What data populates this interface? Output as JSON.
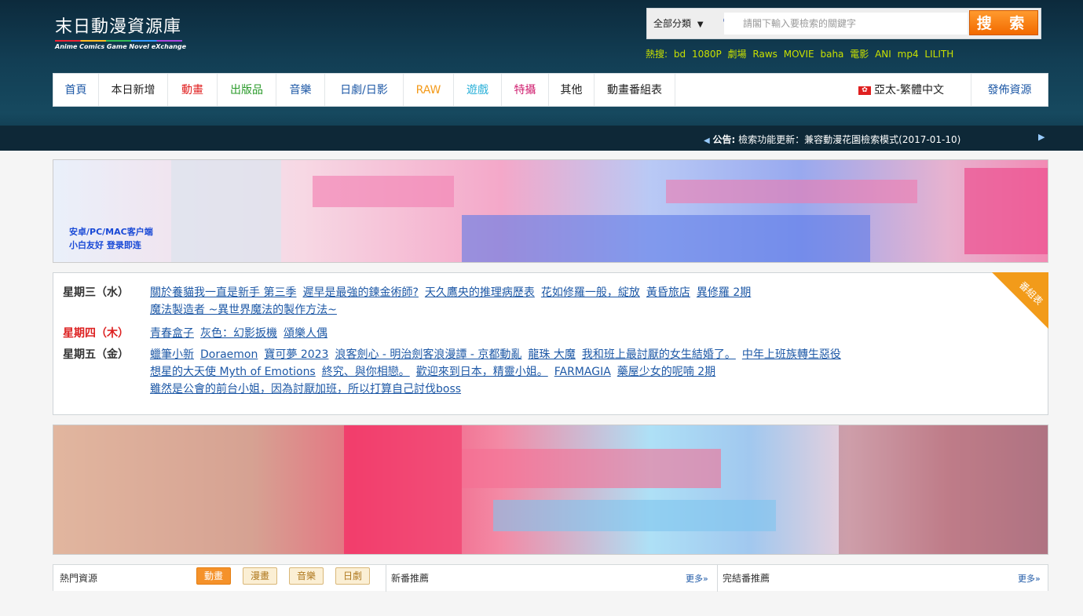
{
  "logo": {
    "name": "末日動漫資源庫",
    "tagline": "Anime Comics Game Novel eXchange"
  },
  "search": {
    "category": "全部分類",
    "placeholder": "請閣下輸入要檢索的關鍵字",
    "button": "搜 索"
  },
  "hot_search": {
    "label": "熱搜:",
    "terms": [
      "bd",
      "1080P",
      "劇場",
      "Raws",
      "MOVIE",
      "baha",
      "電影",
      "ANI",
      "mp4",
      "LILITH"
    ]
  },
  "nav": {
    "items": [
      {
        "label": "首頁",
        "color": "#1d58a6"
      },
      {
        "label": "本日新增",
        "color": "#222222"
      },
      {
        "label": "動畫",
        "color": "#e02020"
      },
      {
        "label": "出版品",
        "color": "#2a9a2a"
      },
      {
        "label": "音樂",
        "color": "#1d58a6"
      },
      {
        "label": "日劇/日影",
        "color": "#1d58a6"
      },
      {
        "label": "RAW",
        "color": "#f39a1a"
      },
      {
        "label": "遊戲",
        "color": "#2ab0d8"
      },
      {
        "label": "特攝",
        "color": "#d02070"
      },
      {
        "label": "其他",
        "color": "#222222"
      },
      {
        "label": "動畫番組表",
        "color": "#222222"
      }
    ],
    "region": "亞太-繁體中文",
    "publish": "發佈資源"
  },
  "announcement": {
    "label": "公告:",
    "text": "檢索功能更新：兼容動漫花園檢索模式(2017-01-10)"
  },
  "banner1": {
    "lines": [
      "安卓/PC/MAC客户端",
      "小白友好 登录即连"
    ]
  },
  "schedule": {
    "corner_label": "番組表",
    "days": [
      {
        "day": "星期三（水）",
        "today": false,
        "titles": [
          "關於養貓我一直是新手 第三季",
          "遲早是最強的鍊金術師?",
          "天久鷹央的推理病歷表",
          "花如修羅一般，綻放",
          "黃昏旅店",
          "異修羅 2期",
          "魔法製造者 ~異世界魔法的製作方法~"
        ]
      },
      {
        "day": "星期四（木）",
        "today": true,
        "titles": [
          "青春盒子",
          "灰色：幻影扳機",
          "頌樂人偶"
        ]
      },
      {
        "day": "星期五（金）",
        "today": false,
        "titles": [
          "蠟筆小新",
          "Doraemon",
          "寶可夢 2023",
          "浪客劍心 - 明治劍客浪漫譚 - 京都動亂",
          "龍珠 大魔",
          "我和班上最討厭的女生結婚了。",
          "中年上班族轉生惡役",
          "想星的大天使 Myth of Emotions",
          "終究、與你相戀。",
          "歡迎來到日本，精靈小姐。",
          "FARMAGIA",
          "藥屋少女的呢喃 2期",
          "雖然是公會的前台小姐，因為討厭加班，所以打算自己討伐boss"
        ]
      }
    ]
  },
  "panels": {
    "hot": {
      "title": "熱門資源",
      "tabs": [
        "動畫",
        "漫畫",
        "音樂",
        "日劇"
      ]
    },
    "new": {
      "title": "新番推薦",
      "more": "更多»"
    },
    "finished": {
      "title": "完結番推薦",
      "more": "更多»"
    }
  }
}
